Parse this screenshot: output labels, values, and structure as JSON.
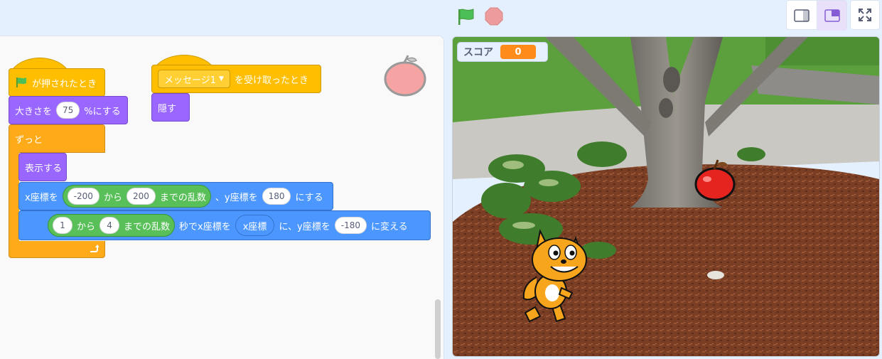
{
  "header": {
    "green_flag_icon": "green-flag",
    "stop_icon": "stop-sign",
    "small_stage_icon": "small-stage-layout",
    "normal_stage_icon": "normal-stage-layout",
    "fullscreen_icon": "fullscreen"
  },
  "script1": {
    "hat_text": "が押されたとき",
    "size_pre": "大きさを",
    "size_value": "75",
    "size_post": "%にする",
    "forever": "ずっと",
    "show": "表示する",
    "goto_x_label": "x座標を",
    "rand1_from": "-200",
    "rand1_kara": "から",
    "rand1_to": "200",
    "rand1_post": "までの乱数",
    "goto_y_label": "、y座標を",
    "goto_y_value": "180",
    "goto_post": "にする",
    "rand2_from": "1",
    "rand2_kara": "から",
    "rand2_to": "4",
    "rand2_post": "までの乱数",
    "glide_mid": "秒でx座標を",
    "x_position": "x座標",
    "glide_y_label": "に、y座標を",
    "glide_y_value": "-180",
    "glide_post": "に変える"
  },
  "script2": {
    "message": "メッセージ1",
    "receive_text": "を受け取ったとき",
    "hide": "隠す"
  },
  "stage": {
    "score_label": "スコア",
    "score_value": "0"
  },
  "colors": {
    "events": "#ffbf00",
    "looks": "#9966ff",
    "motion": "#4c97ff",
    "control": "#ffab19",
    "operators": "#59c059",
    "accent": "#855cd6"
  }
}
